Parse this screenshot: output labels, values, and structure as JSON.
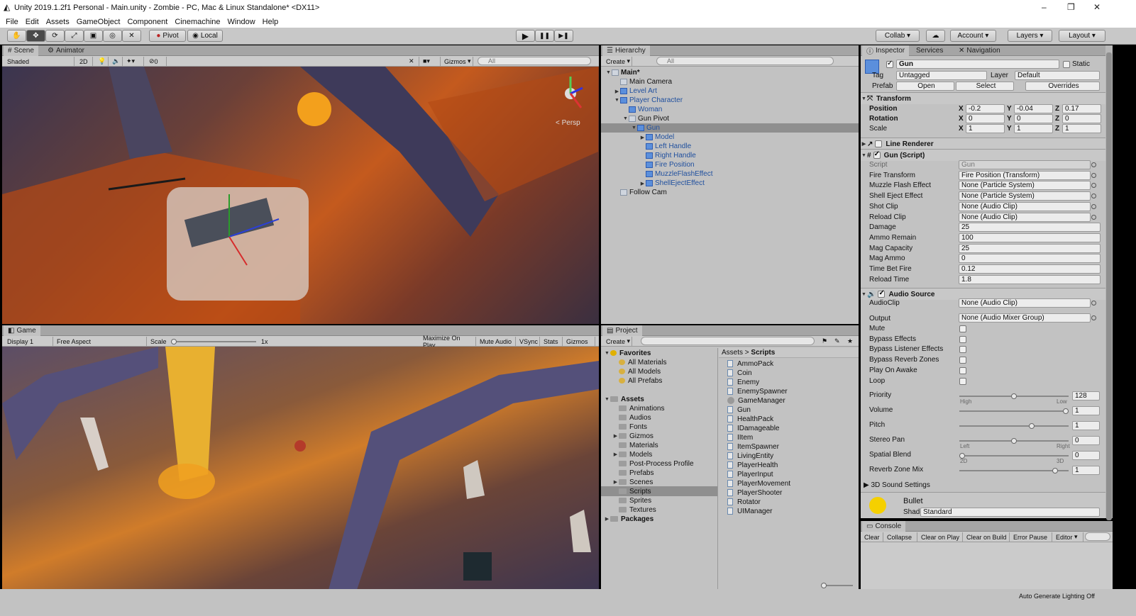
{
  "window": {
    "title": "Unity 2019.1.2f1 Personal - Main.unity - Zombie - PC, Mac & Linux Standalone* <DX11>",
    "controls": [
      "–",
      "❐",
      "✕"
    ]
  },
  "menu": [
    "File",
    "Edit",
    "Assets",
    "GameObject",
    "Component",
    "Cinemachine",
    "Window",
    "Help"
  ],
  "toolbar": {
    "pivot": "Pivot",
    "local": "Local",
    "collab": "Collab",
    "account": "Account",
    "layers": "Layers",
    "layout": "Layout",
    "play": "▶",
    "pause": "❚❚",
    "step": "▶❚"
  },
  "scene": {
    "tabs": [
      "Scene",
      "Animator"
    ],
    "shading": "Shaded",
    "mode2d": "2D",
    "gizmos": "Gizmos",
    "search": "All",
    "persp": "Persp",
    "hidden_count": "0"
  },
  "game": {
    "tab": "Game",
    "display": "Display 1",
    "aspect": "Free Aspect",
    "scale_label": "Scale",
    "scale_value": "1x",
    "buttons": [
      "Maximize On Play",
      "Mute Audio",
      "VSync",
      "Stats",
      "Gizmos"
    ]
  },
  "hierarchy": {
    "tab": "Hierarchy",
    "create": "Create",
    "search": "All",
    "rows": [
      {
        "text": "Main*",
        "indent": 0,
        "arrow": "▼",
        "bold": true,
        "blue": false,
        "sel": false
      },
      {
        "text": "Main Camera",
        "indent": 1,
        "arrow": "",
        "bold": false,
        "blue": false,
        "sel": false
      },
      {
        "text": "Level Art",
        "indent": 1,
        "arrow": "▶",
        "bold": false,
        "blue": true,
        "sel": false
      },
      {
        "text": "Player Character",
        "indent": 1,
        "arrow": "▼",
        "bold": false,
        "blue": true,
        "sel": false
      },
      {
        "text": "Woman",
        "indent": 2,
        "arrow": "",
        "bold": false,
        "blue": true,
        "sel": false
      },
      {
        "text": "Gun Pivot",
        "indent": 2,
        "arrow": "▼",
        "bold": false,
        "blue": false,
        "sel": false
      },
      {
        "text": "Gun",
        "indent": 3,
        "arrow": "▼",
        "bold": false,
        "blue": true,
        "sel": true
      },
      {
        "text": "Model",
        "indent": 4,
        "arrow": "▶",
        "bold": false,
        "blue": true,
        "sel": false
      },
      {
        "text": "Left Handle",
        "indent": 4,
        "arrow": "",
        "bold": false,
        "blue": true,
        "sel": false
      },
      {
        "text": "Right Handle",
        "indent": 4,
        "arrow": "",
        "bold": false,
        "blue": true,
        "sel": false
      },
      {
        "text": "Fire Position",
        "indent": 4,
        "arrow": "",
        "bold": false,
        "blue": true,
        "sel": false
      },
      {
        "text": "MuzzleFlashEffect",
        "indent": 4,
        "arrow": "",
        "bold": false,
        "blue": true,
        "sel": false
      },
      {
        "text": "ShellEjectEffect",
        "indent": 4,
        "arrow": "▶",
        "bold": false,
        "blue": true,
        "sel": false
      },
      {
        "text": "Follow Cam",
        "indent": 1,
        "arrow": "",
        "bold": false,
        "blue": false,
        "sel": false
      }
    ]
  },
  "project": {
    "tab": "Project",
    "create": "Create",
    "favorites_label": "Favorites",
    "favorites": [
      "All Materials",
      "All Models",
      "All Prefabs"
    ],
    "assets_label": "Assets",
    "folders": [
      {
        "name": "Animations",
        "arrow": ""
      },
      {
        "name": "Audios",
        "arrow": ""
      },
      {
        "name": "Fonts",
        "arrow": ""
      },
      {
        "name": "Gizmos",
        "arrow": "▶"
      },
      {
        "name": "Materials",
        "arrow": ""
      },
      {
        "name": "Models",
        "arrow": "▶"
      },
      {
        "name": "Post-Process Profile",
        "arrow": ""
      },
      {
        "name": "Prefabs",
        "arrow": ""
      },
      {
        "name": "Scenes",
        "arrow": "▶"
      },
      {
        "name": "Scripts",
        "arrow": "",
        "sel": true
      },
      {
        "name": "Sprites",
        "arrow": ""
      },
      {
        "name": "Textures",
        "arrow": ""
      }
    ],
    "packages_label": "Packages",
    "breadcrumb": [
      "Assets",
      "Scripts"
    ],
    "scripts": [
      "AmmoPack",
      "Coin",
      "Enemy",
      "EnemySpawner",
      "GameManager",
      "Gun",
      "HealthPack",
      "IDamageable",
      "IItem",
      "ItemSpawner",
      "LivingEntity",
      "PlayerHealth",
      "PlayerInput",
      "PlayerMovement",
      "PlayerShooter",
      "Rotator",
      "UIManager"
    ]
  },
  "inspector": {
    "tabs": [
      "Inspector",
      "Services",
      "Navigation"
    ],
    "object_name": "Gun",
    "static_label": "Static",
    "tag_label": "Tag",
    "tag": "Untagged",
    "layer_label": "Layer",
    "layer": "Default",
    "prefab_label": "Prefab",
    "prefab_open": "Open",
    "prefab_select": "Select",
    "prefab_overrides": "Overrides",
    "transform": {
      "title": "Transform",
      "position_label": "Position",
      "rotation_label": "Rotation",
      "scale_label": "Scale",
      "position": [
        "-0.2",
        "-0.04",
        "0.17"
      ],
      "rotation": [
        "0",
        "0",
        "0"
      ],
      "scale": [
        "1",
        "1",
        "1"
      ]
    },
    "line_renderer": "Line Renderer",
    "gun_script": {
      "title": "Gun (Script)",
      "fields": [
        {
          "label": "Script",
          "value": "Gun",
          "dot": true,
          "grey": true
        },
        {
          "label": "Fire Transform",
          "value": "Fire Position (Transform)",
          "dot": true
        },
        {
          "label": "Muzzle Flash Effect",
          "value": "None (Particle System)",
          "dot": true
        },
        {
          "label": "Shell Eject Effect",
          "value": "None (Particle System)",
          "dot": true
        },
        {
          "label": "Shot Clip",
          "value": "None (Audio Clip)",
          "dot": true
        },
        {
          "label": "Reload Clip",
          "value": "None (Audio Clip)",
          "dot": true
        },
        {
          "label": "Damage",
          "value": "25"
        },
        {
          "label": "Ammo Remain",
          "value": "100"
        },
        {
          "label": "Mag Capacity",
          "value": "25"
        },
        {
          "label": "Mag Ammo",
          "value": "0"
        },
        {
          "label": "Time Bet Fire",
          "value": "0.12"
        },
        {
          "label": "Reload Time",
          "value": "1.8"
        }
      ]
    },
    "audio_source": {
      "title": "Audio Source",
      "audioclip_label": "AudioClip",
      "audioclip": "None (Audio Clip)",
      "output_label": "Output",
      "output": "None (Audio Mixer Group)",
      "checks": [
        "Mute",
        "Bypass Effects",
        "Bypass Listener Effects",
        "Bypass Reverb Zones",
        "Play On Awake",
        "Loop"
      ],
      "sliders": [
        {
          "label": "Priority",
          "value": "128",
          "fraction": 0.5,
          "left": "High",
          "right": "Low"
        },
        {
          "label": "Volume",
          "value": "1",
          "fraction": 1.0,
          "left": "",
          "right": ""
        },
        {
          "label": "Pitch",
          "value": "1",
          "fraction": 0.67,
          "left": "",
          "right": ""
        },
        {
          "label": "Stereo Pan",
          "value": "0",
          "fraction": 0.5,
          "left": "Left",
          "right": "Right"
        },
        {
          "label": "Spatial Blend",
          "value": "0",
          "fraction": 0.0,
          "left": "2D",
          "right": "3D"
        },
        {
          "label": "Reverb Zone Mix",
          "value": "1",
          "fraction": 0.9,
          "left": "",
          "right": ""
        }
      ],
      "sound3d": "3D Sound Settings"
    },
    "material": {
      "name": "Bullet",
      "shader_label": "Shader",
      "shader": "Standard"
    }
  },
  "console": {
    "tab": "Console",
    "buttons": [
      "Clear",
      "Collapse",
      "Clear on Play",
      "Clear on Build",
      "Error Pause",
      "Editor"
    ]
  },
  "status": {
    "lighting": "Auto Generate Lighting Off"
  }
}
